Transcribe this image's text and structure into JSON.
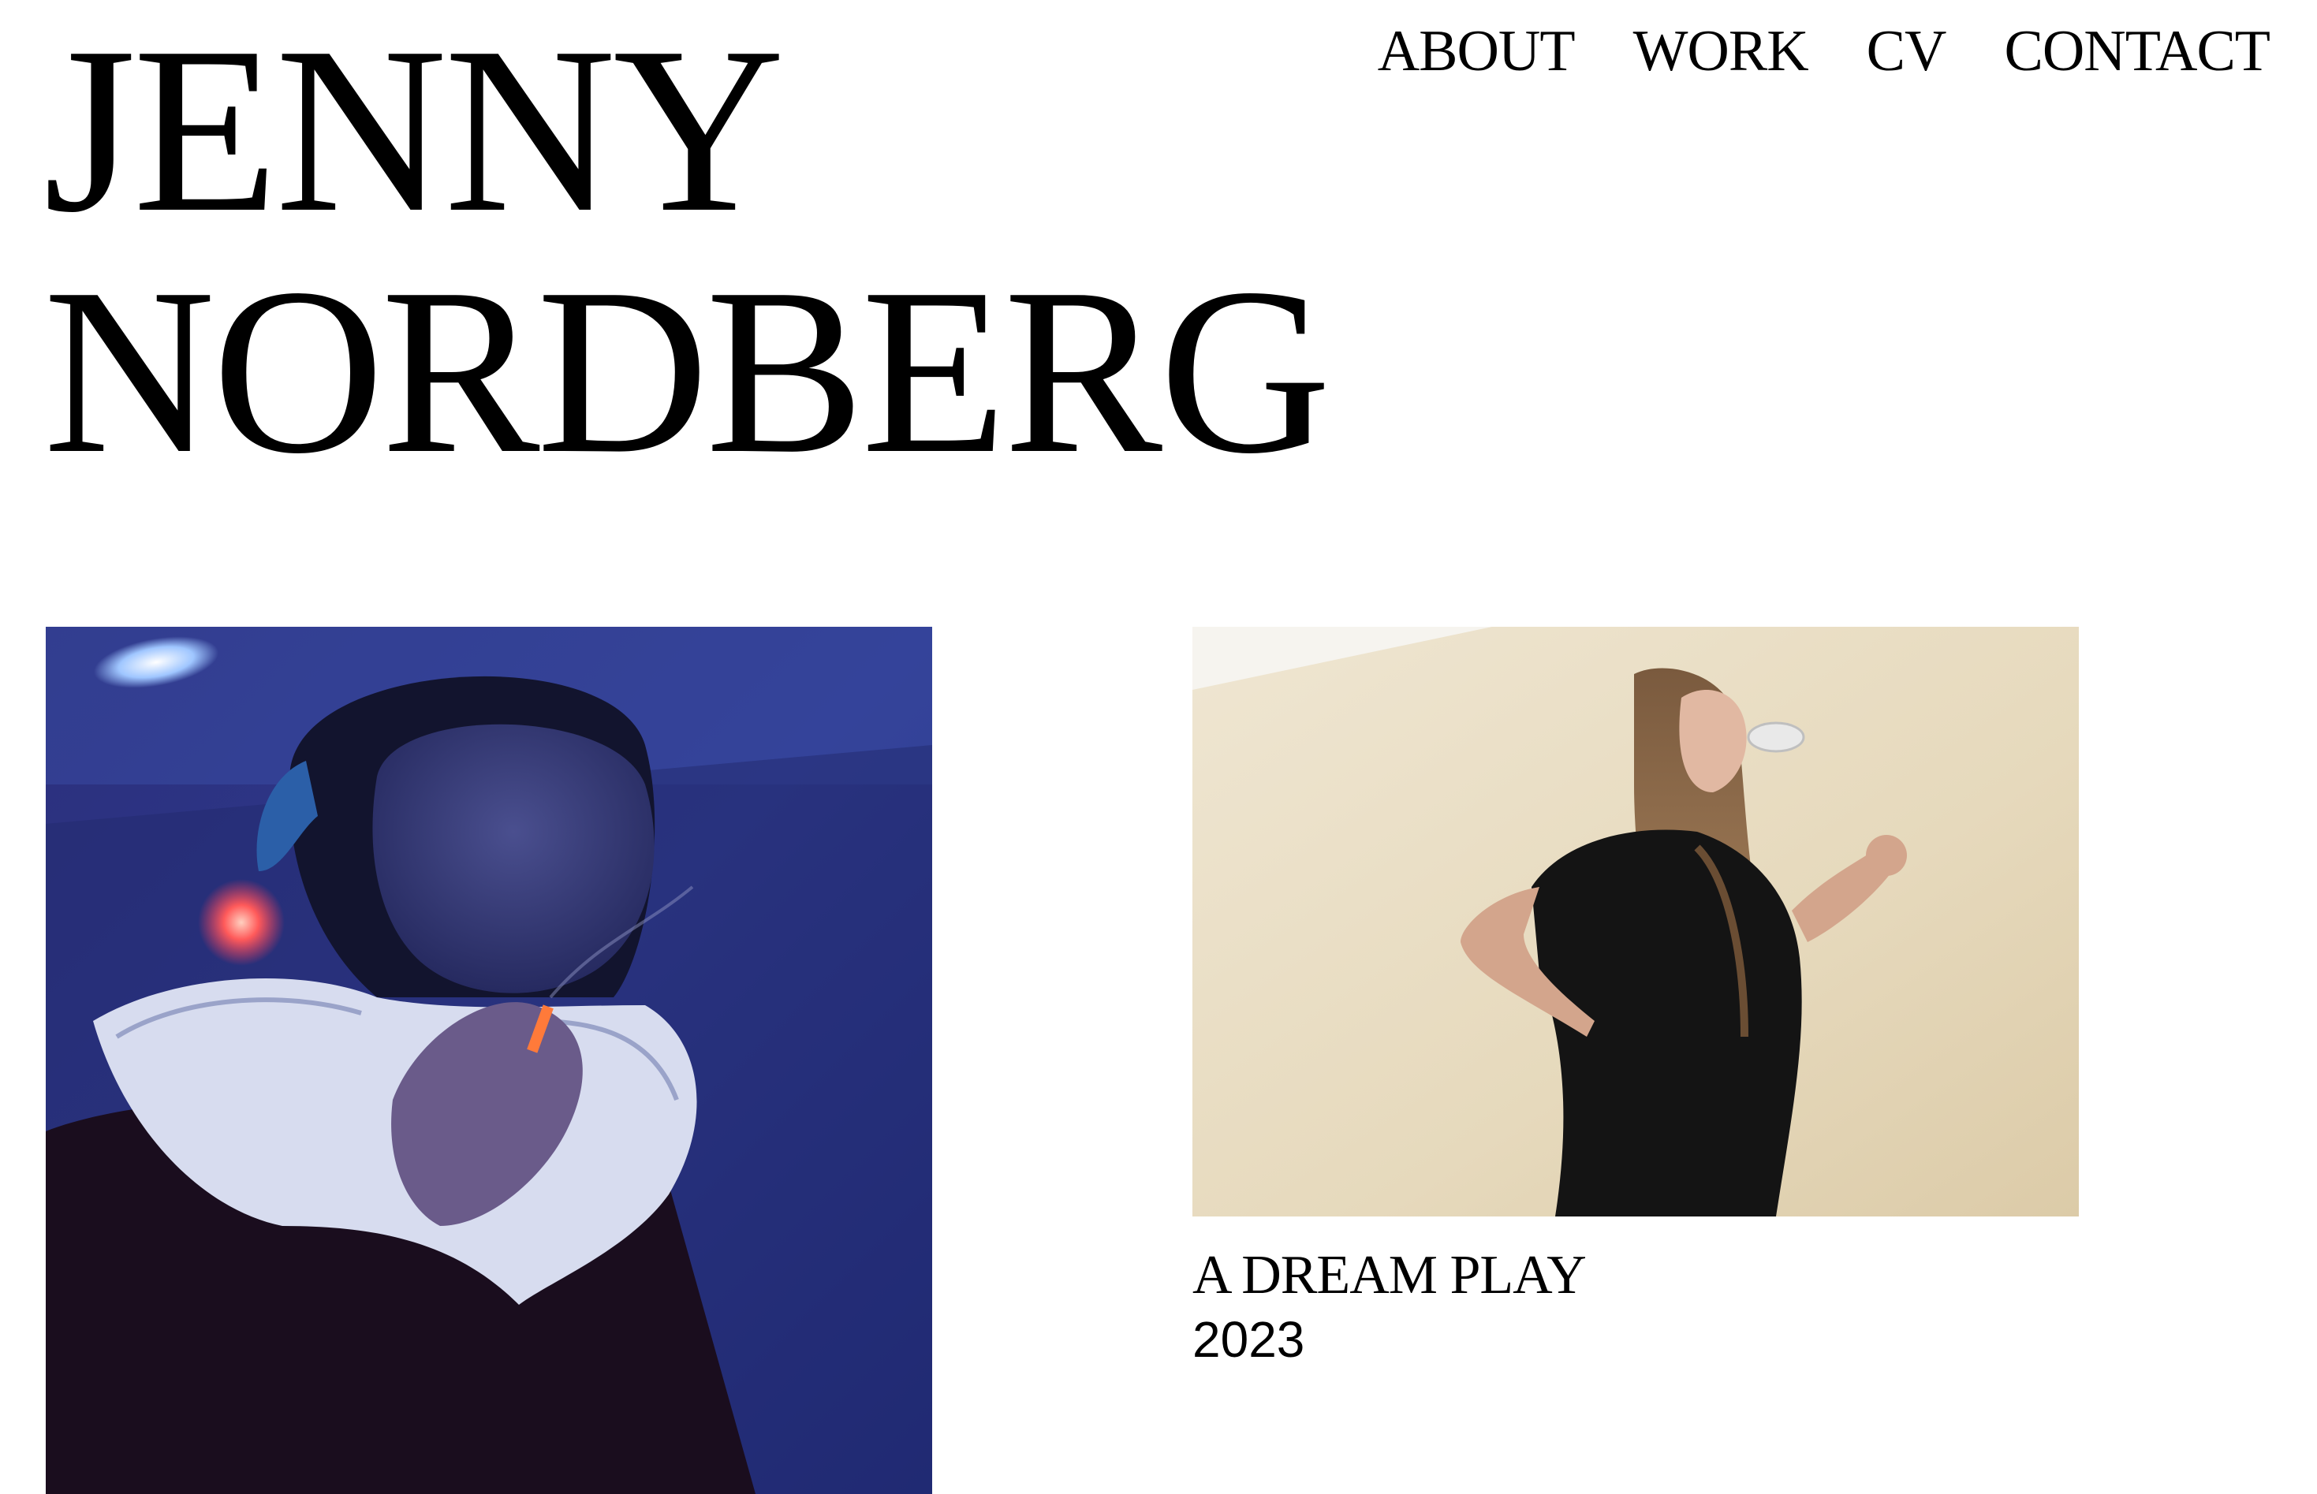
{
  "header": {
    "title_line1": "JENNY",
    "title_line2": "NORDBERG"
  },
  "nav": {
    "items": [
      {
        "label": "ABOUT"
      },
      {
        "label": "WORK"
      },
      {
        "label": "CV"
      },
      {
        "label": "CONTACT"
      }
    ]
  },
  "projects": [
    {
      "title": "",
      "year": "",
      "image": "photo-woman-smoking-blue-light"
    },
    {
      "title": "A DREAM PLAY",
      "year": "2023",
      "image": "photo-woman-against-textured-wall"
    }
  ]
}
